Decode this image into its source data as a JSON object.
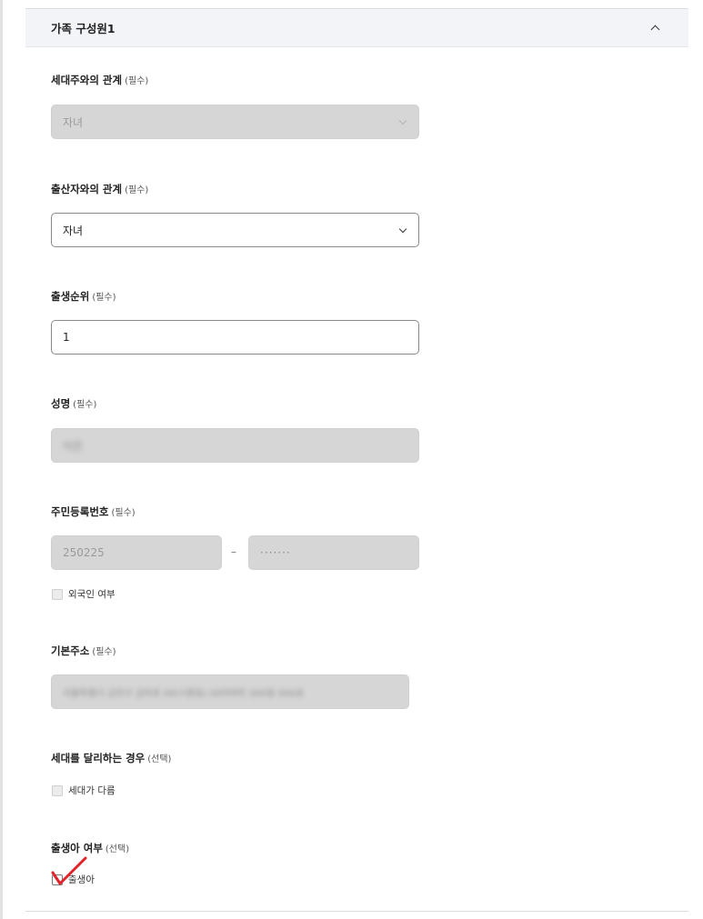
{
  "section": {
    "title": "가족 구성원1",
    "collapse_icon": "chevron-up-icon"
  },
  "relation_householder": {
    "label": "세대주와의 관계",
    "req": "(필수)",
    "value": "자녀",
    "disabled": true
  },
  "relation_parent": {
    "label": "출산자와의 관계",
    "req": "(필수)",
    "value": "자녀",
    "disabled": false
  },
  "birth_order": {
    "label": "출생순위",
    "req": "(필수)",
    "value": "1"
  },
  "name": {
    "label": "성명",
    "req": "(필수)",
    "value": "이은"
  },
  "rrn": {
    "label": "주민등록번호",
    "req": "(필수)",
    "front": "250225",
    "separator": "–",
    "back": "·······",
    "foreigner_label": "외국인 여부"
  },
  "address": {
    "label": "기본주소",
    "req": "(필수)",
    "value": "서울특별시 금천구 금하로 00(시흥동) 00아파트 000동 000호"
  },
  "separate_household": {
    "label": "세대를 달리하는 경우",
    "req": "(선택)",
    "checkbox_label": "세대가 다름"
  },
  "newborn": {
    "label": "출생아 여부",
    "req": "(선택)",
    "checkbox_label": "출생아",
    "annotation_color": "#e0242c"
  }
}
